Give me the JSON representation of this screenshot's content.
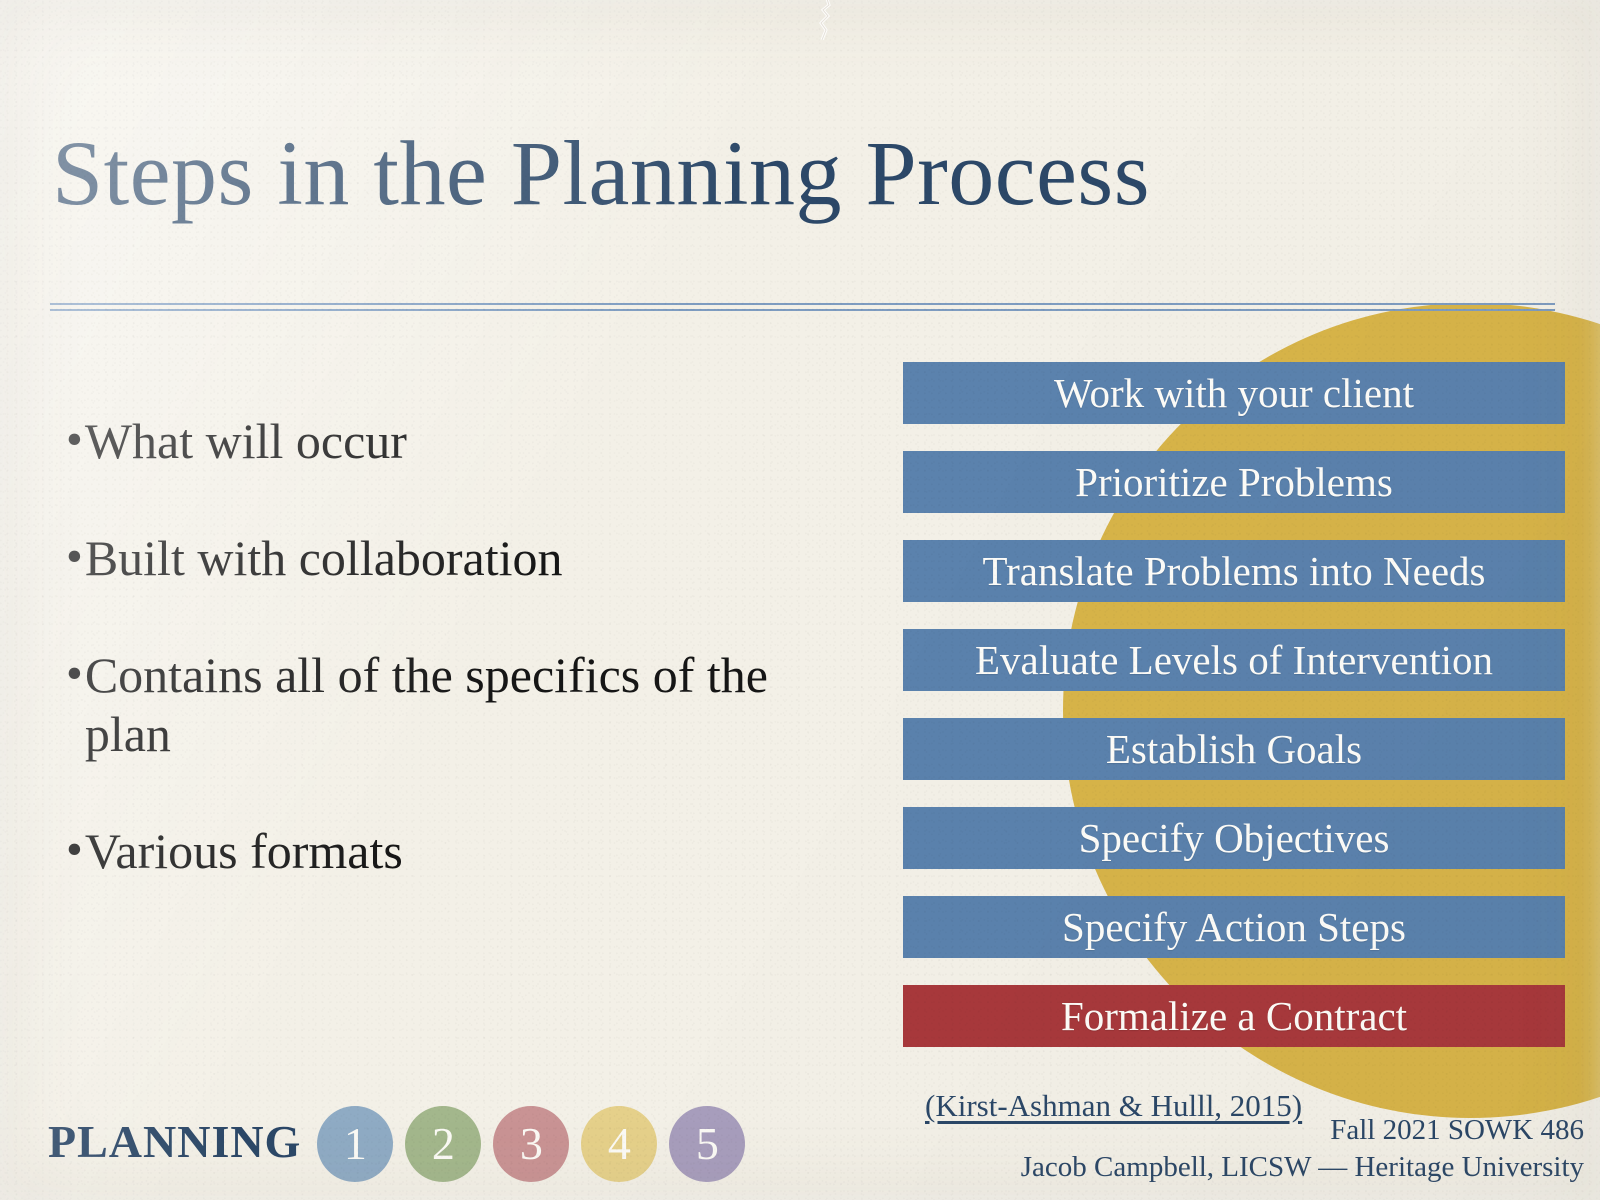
{
  "slide": {
    "title": "Steps in the Planning Process",
    "background_color": "#f3f0e7",
    "accent_navy": "#2c4868",
    "accent_gold": "#d4af3f",
    "accent_blue": "#5b82ad",
    "accent_red": "#a8393c"
  },
  "bullets": [
    {
      "marker": "•",
      "text": "What will occur"
    },
    {
      "marker": "•",
      "text": "Built with collaboration"
    },
    {
      "marker": "•",
      "text": "Contains all of the specifics of the plan"
    },
    {
      "marker": "•",
      "text": "Various formats"
    }
  ],
  "steps": [
    {
      "label": "Work with your client",
      "color": "#5b82ad"
    },
    {
      "label": "Prioritize Problems",
      "color": "#5b82ad"
    },
    {
      "label": "Translate Problems into Needs",
      "color": "#5b82ad"
    },
    {
      "label": "Evaluate Levels of Intervention",
      "color": "#5b82ad"
    },
    {
      "label": "Establish Goals",
      "color": "#5b82ad"
    },
    {
      "label": "Specify Objectives",
      "color": "#5b82ad"
    },
    {
      "label": "Specify Action Steps",
      "color": "#5b82ad"
    },
    {
      "label": "Formalize a Contract",
      "color": "#a8393c"
    }
  ],
  "footer": {
    "section_label": "PLANNING",
    "step_circles": [
      {
        "number": "1",
        "color": "#8fabc4"
      },
      {
        "number": "2",
        "color": "#a3b78c"
      },
      {
        "number": "3",
        "color": "#c99394"
      },
      {
        "number": "4",
        "color": "#e5d08a"
      },
      {
        "number": "5",
        "color": "#a89ebd"
      }
    ],
    "citation": "(Kirst-Ashman & Hulll, 2015)",
    "course": "Fall 2021 SOWK 486",
    "presenter": "Jacob Campbell, LICSW — Heritage University"
  }
}
